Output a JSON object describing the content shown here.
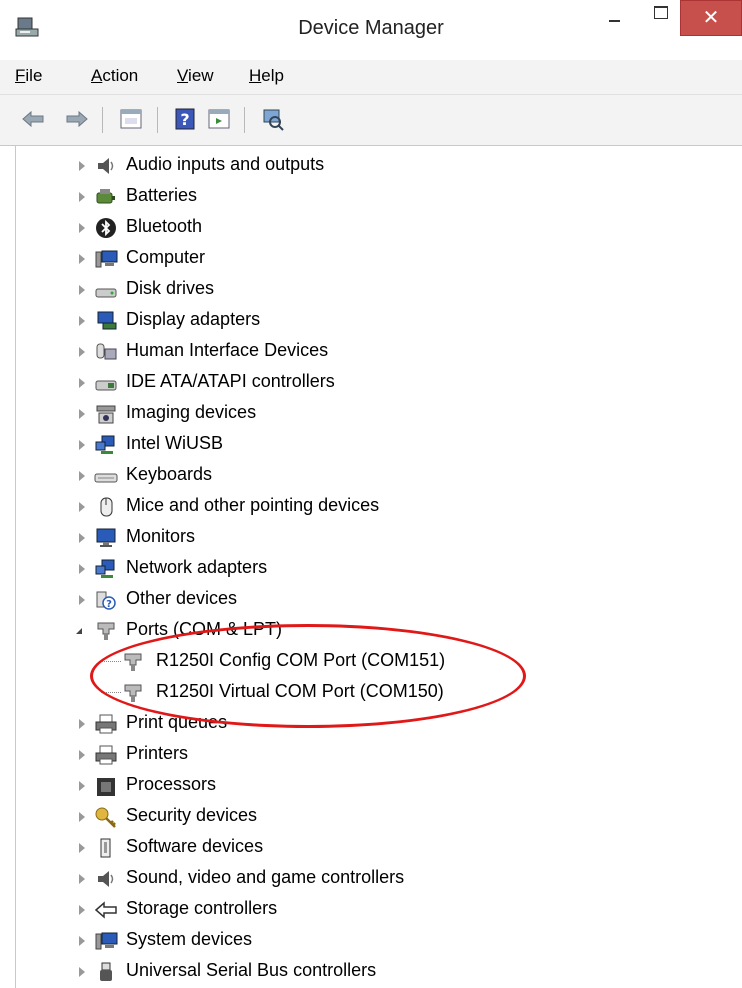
{
  "window": {
    "title": "Device Manager",
    "close_glyph": "✕"
  },
  "menu": [
    "File",
    "Action",
    "View",
    "Help"
  ],
  "toolbar": [
    "back-arrow-icon",
    "forward-arrow-icon",
    "properties-icon",
    "help-icon",
    "update-driver-icon",
    "scan-hardware-icon"
  ],
  "tree": {
    "items": [
      {
        "label": "Audio inputs and outputs",
        "icon": "speaker-icon"
      },
      {
        "label": "Batteries",
        "icon": "battery-icon"
      },
      {
        "label": "Bluetooth",
        "icon": "bluetooth-icon"
      },
      {
        "label": "Computer",
        "icon": "computer-icon"
      },
      {
        "label": "Disk drives",
        "icon": "disk-drive-icon"
      },
      {
        "label": "Display adapters",
        "icon": "display-adapter-icon"
      },
      {
        "label": "Human Interface Devices",
        "icon": "hid-icon"
      },
      {
        "label": "IDE ATA/ATAPI controllers",
        "icon": "ide-controller-icon"
      },
      {
        "label": "Imaging devices",
        "icon": "camera-icon"
      },
      {
        "label": "Intel WiUSB",
        "icon": "network-icon"
      },
      {
        "label": "Keyboards",
        "icon": "keyboard-icon"
      },
      {
        "label": "Mice and other pointing devices",
        "icon": "mouse-icon"
      },
      {
        "label": "Monitors",
        "icon": "monitor-icon"
      },
      {
        "label": "Network adapters",
        "icon": "network-icon"
      },
      {
        "label": "Other devices",
        "icon": "unknown-device-icon"
      },
      {
        "label": "Ports (COM & LPT)",
        "icon": "port-icon",
        "expanded": true
      },
      {
        "label": "R1250I Config COM Port (COM151)",
        "icon": "port-icon",
        "child": true
      },
      {
        "label": "R1250I Virtual COM Port (COM150)",
        "icon": "port-icon",
        "child": true
      },
      {
        "label": "Print queues",
        "icon": "printer-icon"
      },
      {
        "label": "Printers",
        "icon": "printer-icon"
      },
      {
        "label": "Processors",
        "icon": "processor-icon"
      },
      {
        "label": "Security devices",
        "icon": "key-icon"
      },
      {
        "label": "Software devices",
        "icon": "software-device-icon"
      },
      {
        "label": "Sound, video and game controllers",
        "icon": "speaker-icon"
      },
      {
        "label": "Storage controllers",
        "icon": "storage-icon"
      },
      {
        "label": "System devices",
        "icon": "computer-icon"
      },
      {
        "label": "Universal Serial Bus controllers",
        "icon": "usb-icon"
      }
    ]
  },
  "colors": {
    "highlight_ellipse": "#e01818",
    "close_button": "#c7504c"
  }
}
